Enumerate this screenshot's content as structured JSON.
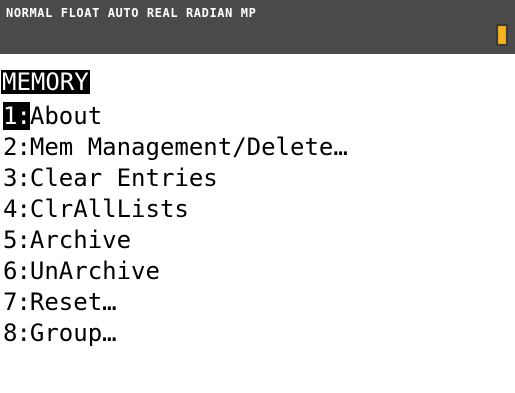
{
  "status_bar": {
    "text": "NORMAL FLOAT AUTO REAL RADIAN MP",
    "battery_color": "#f5b520"
  },
  "menu": {
    "title": "MEMORY",
    "items": [
      {
        "number": "1:",
        "label": "About",
        "selected": true
      },
      {
        "number": "2:",
        "label": "Mem Management/Delete…",
        "selected": false
      },
      {
        "number": "3:",
        "label": "Clear Entries",
        "selected": false
      },
      {
        "number": "4:",
        "label": "ClrAllLists",
        "selected": false
      },
      {
        "number": "5:",
        "label": "Archive",
        "selected": false
      },
      {
        "number": "6:",
        "label": "UnArchive",
        "selected": false
      },
      {
        "number": "7:",
        "label": "Reset…",
        "selected": false
      },
      {
        "number": "8:",
        "label": "Group…",
        "selected": false
      }
    ]
  }
}
